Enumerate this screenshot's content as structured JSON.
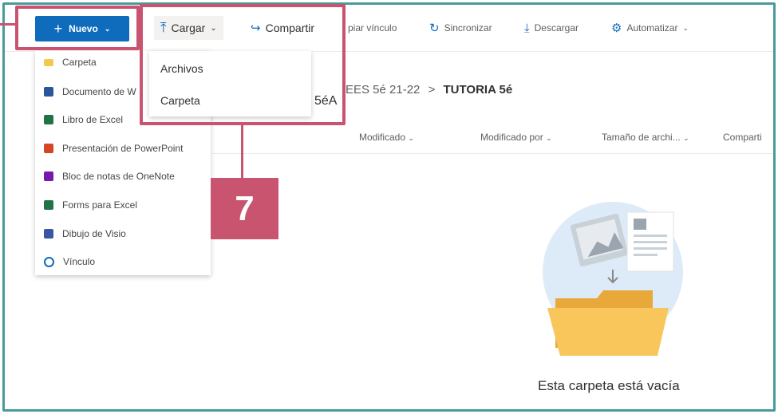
{
  "toolbar": {
    "new_label": "Nuevo",
    "upload_label": "Cargar",
    "share_label": "Compartir",
    "copy_link_label": "piar vínculo",
    "sync_label": "Sincronizar",
    "download_label": "Descargar",
    "automate_label": "Automatizar"
  },
  "new_menu": {
    "items": [
      {
        "label": "Carpeta",
        "icon": "folder-icon"
      },
      {
        "label": "Documento de W",
        "icon": "word-icon"
      },
      {
        "label": "Libro de Excel",
        "icon": "excel-icon"
      },
      {
        "label": "Presentación de PowerPoint",
        "icon": "powerpoint-icon"
      },
      {
        "label": "Bloc de notas de OneNote",
        "icon": "onenote-icon"
      },
      {
        "label": "Forms para Excel",
        "icon": "forms-icon"
      },
      {
        "label": "Dibujo de Visio",
        "icon": "visio-icon"
      },
      {
        "label": "Vínculo",
        "icon": "link-icon"
      }
    ]
  },
  "upload_menu": {
    "items": [
      "Archivos",
      "Carpeta"
    ]
  },
  "breadcrumb": {
    "parent": "EES 5é 21-22",
    "separator": ">",
    "current": "TUTORIA 5é"
  },
  "library_fragment": "5éA",
  "columns": [
    "Modificado",
    "Modificado por",
    "Tamaño de archi...",
    "Comparti"
  ],
  "empty_state": {
    "message": "Esta carpeta está vacía"
  },
  "annotation": {
    "step_number": "7",
    "color": "#c85470"
  },
  "colors": {
    "accent": "#0f6cbd",
    "frame": "#4a9a9c"
  }
}
